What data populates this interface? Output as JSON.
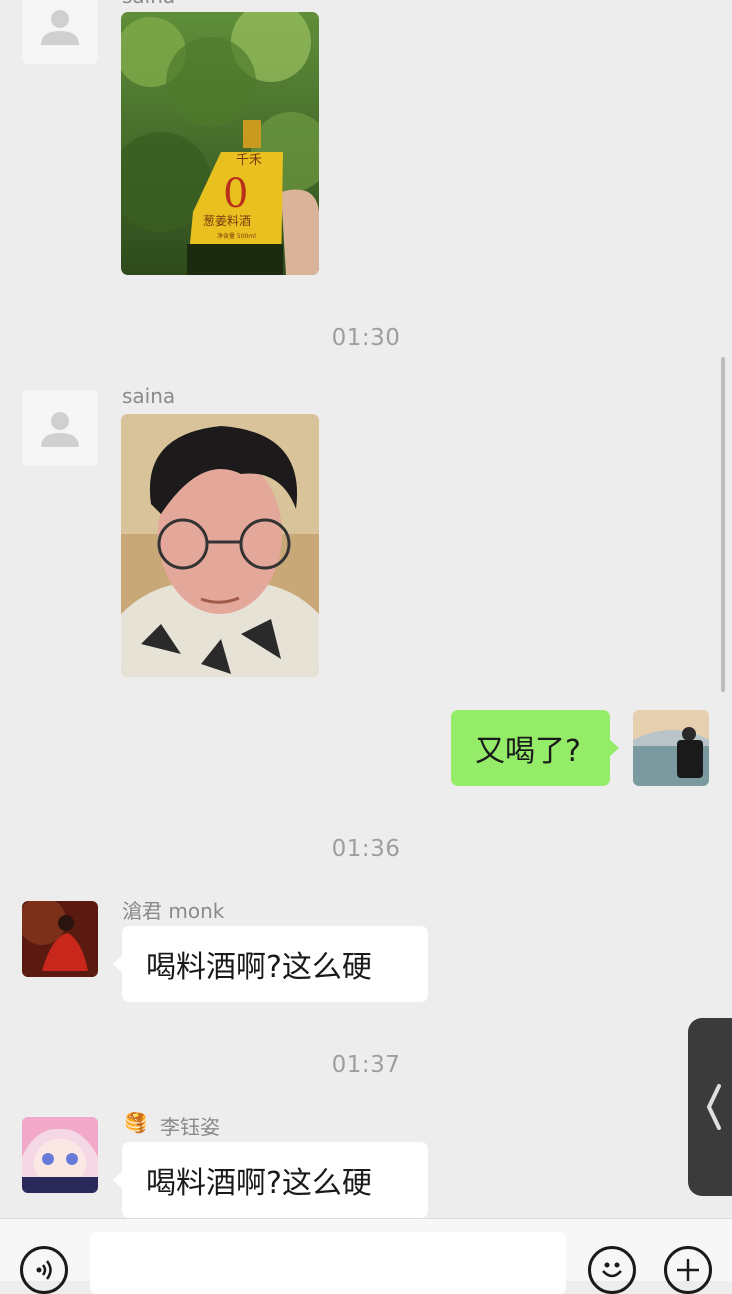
{
  "messages": [
    {
      "sender": "saina"
    },
    {
      "timestamp": "01:30"
    },
    {
      "sender": "saina"
    },
    {
      "text": "又喝了?"
    },
    {
      "timestamp": "01:36"
    },
    {
      "sender": "滄君 monk",
      "text": "喝料酒啊?这么硬"
    },
    {
      "timestamp": "01:37"
    },
    {
      "sender": "李钰姿",
      "sender_badge": "🥞",
      "text": "喝料酒啊?这么硬"
    }
  ],
  "photo1": {
    "brand_text": "千禾",
    "big_digit": "0",
    "label_text": "葱姜料酒",
    "volume_text": "净含量 500ml"
  },
  "input": {
    "value": "",
    "placeholder": ""
  },
  "icons": {
    "voice": "voice-icon",
    "emoji": "emoji-icon",
    "plus": "plus-icon",
    "handle": "chevron-left-icon"
  },
  "colors": {
    "background": "#ededed",
    "own_bubble": "#95ec69",
    "other_bubble": "#ffffff",
    "timestamp": "#9e9e9e"
  }
}
